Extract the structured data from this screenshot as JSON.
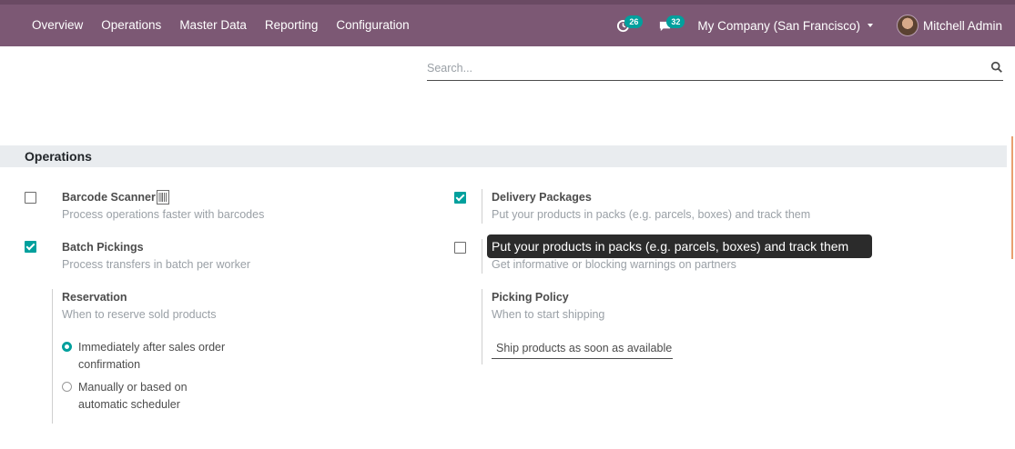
{
  "navbar": {
    "menu": [
      "Overview",
      "Operations",
      "Master Data",
      "Reporting",
      "Configuration"
    ],
    "activity_badge": "26",
    "messages_badge": "32",
    "company": "My Company (San Francisco)",
    "user": "Mitchell Admin"
  },
  "search": {
    "placeholder": "Search..."
  },
  "section": {
    "title": "Operations"
  },
  "settings": {
    "barcode": {
      "label": "Barcode Scanner",
      "desc": "Process operations faster with barcodes",
      "checked": false
    },
    "batch": {
      "label": "Batch Pickings",
      "desc": "Process transfers in batch per worker",
      "checked": true
    },
    "delivery": {
      "label": "Delivery Packages",
      "desc": "Put your products in packs (e.g. parcels, boxes) and track them",
      "checked": true
    },
    "warnings": {
      "desc": "Get informative or blocking warnings on partners",
      "checked": false
    },
    "reservation": {
      "label": "Reservation",
      "desc": "When to reserve sold products",
      "options": [
        "Immediately after sales order confirmation",
        "Manually or based on automatic scheduler"
      ]
    },
    "picking_policy": {
      "label": "Picking Policy",
      "desc": "When to start shipping",
      "selected": "Ship products as soon as available, with back orders"
    }
  },
  "tooltip": {
    "text": "Put your products in packs (e.g. parcels, boxes) and track them"
  },
  "colors": {
    "navbar": "#7c5874",
    "accent": "#00a09d"
  }
}
